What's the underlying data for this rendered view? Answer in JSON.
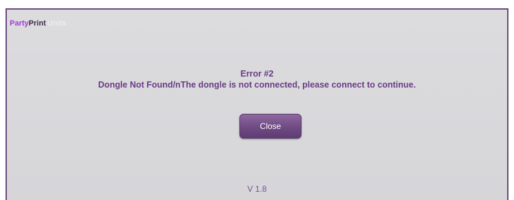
{
  "logo": {
    "party": "Party",
    "print": "Print",
    "suffix": "Units"
  },
  "error": {
    "title": "Error #2",
    "message": "Dongle Not Found/nThe dongle is not connected, please connect to continue."
  },
  "buttons": {
    "close_label": "Close"
  },
  "footer": {
    "version": "V 1.8"
  },
  "colors": {
    "accent": "#6a3c86",
    "button": "#6f4a83",
    "background": "#d8d8db",
    "border": "#6b4a7d"
  }
}
